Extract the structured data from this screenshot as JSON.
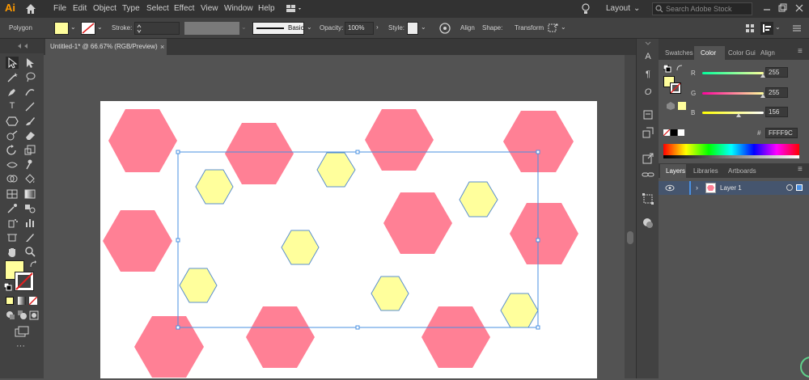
{
  "app": {
    "logo": "Ai"
  },
  "menu": [
    "File",
    "Edit",
    "Object",
    "Type",
    "Select",
    "Effect",
    "View",
    "Window",
    "Help"
  ],
  "workspace": {
    "label": "Layout"
  },
  "search": {
    "placeholder": "Search Adobe Stock"
  },
  "control_bar": {
    "selection_type": "Polygon",
    "fill_color": "#fffe9c",
    "stroke_label": "Stroke:",
    "brush_label": "Basic",
    "opacity_label": "Opacity:",
    "opacity_value": "100%",
    "style_label": "Style:",
    "align_label": "Align",
    "shape_label": "Shape:",
    "transform_label": "Transform"
  },
  "document": {
    "tab_title": "Untitled-1* @ 66.67% (RGB/Preview)"
  },
  "colors": {
    "pink_hexagon": "#ff8095",
    "yellow_hexagon": "#ffff9c",
    "selection": "#4a90e2"
  },
  "color_panel": {
    "tabs": [
      "Swatches",
      "Color",
      "Color Gui",
      "Align"
    ],
    "active_tab": "Color",
    "r_label": "R",
    "r_value": "255",
    "g_label": "G",
    "g_value": "255",
    "b_label": "B",
    "b_value": "156",
    "hex_label": "#",
    "hex_value": "FFFF9C"
  },
  "layers_panel": {
    "tabs": [
      "Layers",
      "Libraries",
      "Artboards"
    ],
    "active_tab": "Layers",
    "layer_name": "Layer 1"
  }
}
